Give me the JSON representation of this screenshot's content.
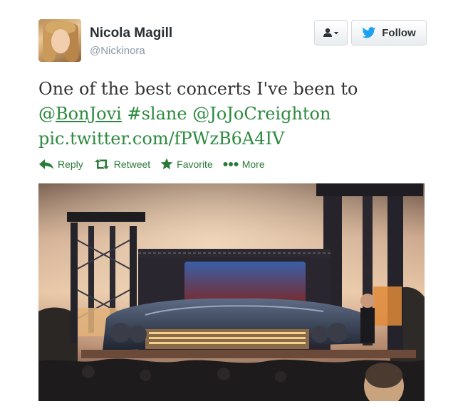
{
  "user": {
    "display_name": "Nicola Magill",
    "handle": "@Nickinora"
  },
  "buttons": {
    "user_menu_icon": "person-icon",
    "follow_label": "Follow"
  },
  "tweet": {
    "line1": "One of the best concerts I've been to",
    "mention1_at": "@",
    "mention1_name": "BonJovi",
    "hashtag": "#slane",
    "mention2": "@JoJoCreighton",
    "link": "pic.twitter.com/fPWzB6A4IV"
  },
  "actions": [
    {
      "label": "Reply",
      "icon": "reply-icon"
    },
    {
      "label": "Retweet",
      "icon": "retweet-icon"
    },
    {
      "label": "Favorite",
      "icon": "star-icon"
    },
    {
      "label": "More",
      "icon": "more-dots-icon"
    }
  ],
  "colors": {
    "link_green": "#2b8a3e",
    "handle_gray": "#8899a6",
    "twitter_blue": "#1da1f2"
  }
}
